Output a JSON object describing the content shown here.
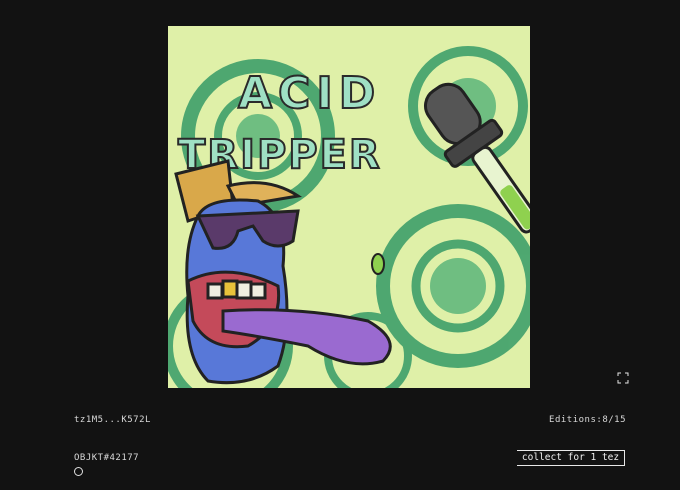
{
  "artwork": {
    "title_line1": "ACID",
    "title_line2": "TRIPPER"
  },
  "creator": {
    "address": "tz1M5...K572L"
  },
  "editions": {
    "label": "Editions:8/15"
  },
  "token": {
    "id": "OBJKT#42177"
  },
  "collect": {
    "label": "collect for 1 tez"
  },
  "icons": {
    "fullscreen": "fullscreen-icon",
    "status": "circle-icon"
  }
}
